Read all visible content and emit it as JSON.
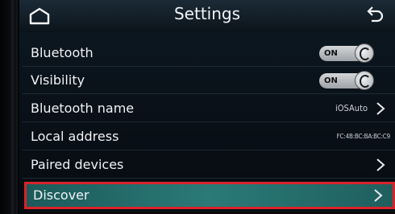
{
  "header": {
    "title": "Settings"
  },
  "icons": {
    "home": "home-icon",
    "back": "back-arrow-icon",
    "chevron": "chevron-right-icon"
  },
  "rows": [
    {
      "label": "Bluetooth",
      "control": "toggle",
      "toggle_label": "ON"
    },
    {
      "label": "Visibility",
      "control": "toggle",
      "toggle_label": "ON"
    },
    {
      "label": "Bluetooth name",
      "value": "iOSAuto",
      "control": "chevron"
    },
    {
      "label": "Local address",
      "value": "FC:4B:BC:BA:BC:C9"
    },
    {
      "label": "Paired devices",
      "control": "chevron"
    },
    {
      "label": "Discover",
      "control": "chevron",
      "selected": true
    }
  ],
  "colors": {
    "selection": "#2a7a78",
    "highlight_border": "#d9232b"
  }
}
